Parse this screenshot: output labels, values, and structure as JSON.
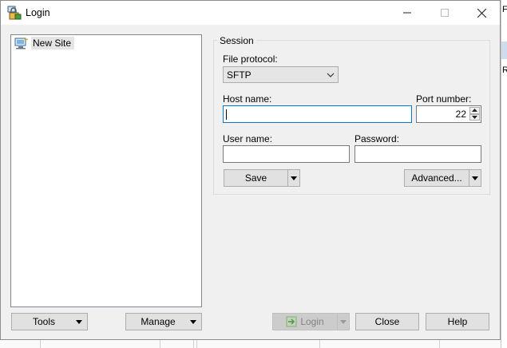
{
  "window": {
    "title": "Login"
  },
  "background": {
    "right_texts": [
      "F",
      "R"
    ]
  },
  "tree": {
    "items": [
      {
        "label": "New Site"
      }
    ]
  },
  "session": {
    "legend": "Session",
    "file_protocol_label": "File protocol:",
    "file_protocol_value": "SFTP",
    "host_name_label": "Host name:",
    "host_name_value": "",
    "port_label": "Port number:",
    "port_value": "22",
    "user_name_label": "User name:",
    "user_name_value": "",
    "password_label": "Password:",
    "password_value": "",
    "save_label": "Save",
    "advanced_label": "Advanced..."
  },
  "footer": {
    "tools_label": "Tools",
    "manage_label": "Manage",
    "login_label": "Login",
    "close_label": "Close",
    "help_label": "Help"
  },
  "icons": {
    "app": "putty-lock-icon",
    "site": "computer-site-icon",
    "login": "login-arrow-icon"
  },
  "colors": {
    "focus_border": "#0078d7",
    "selection": "#e5e5e5",
    "window_bg": "#f0f0f0"
  }
}
